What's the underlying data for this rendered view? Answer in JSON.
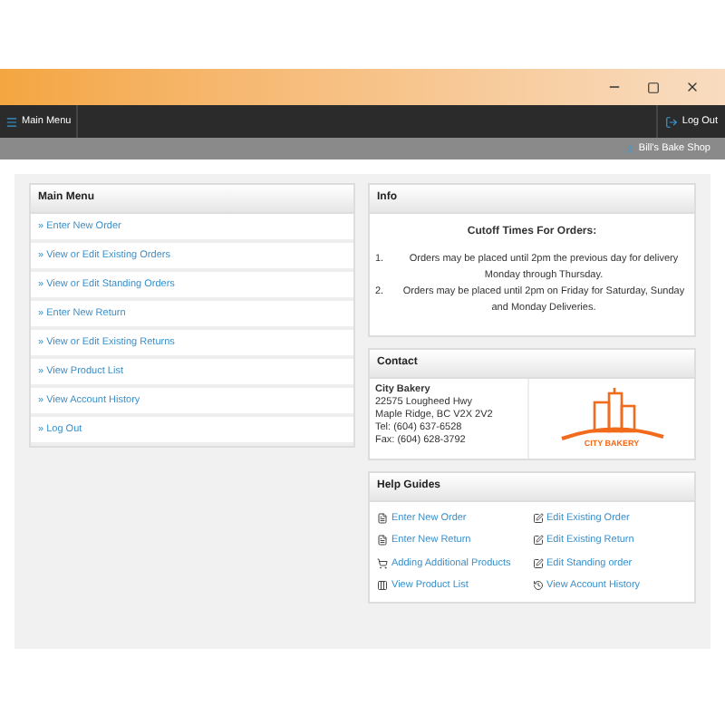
{
  "nav": {
    "menu_label": "Main Menu",
    "logout_label": "Log Out"
  },
  "user_bar": {
    "shop": "Bill's Bake Shop"
  },
  "main_menu": {
    "title": "Main Menu",
    "items": [
      {
        "label": "» Enter New Order"
      },
      {
        "label": "» View or Edit Existing Orders"
      },
      {
        "label": "» View or Edit Standing Orders"
      },
      {
        "label": "» Enter New Return"
      },
      {
        "label": "» View or Edit Existing Returns"
      },
      {
        "label": "» View Product List"
      },
      {
        "label": "» View Account History"
      },
      {
        "label": "» Log Out"
      }
    ]
  },
  "info": {
    "title": "Info",
    "heading": "Cutoff Times For Orders:",
    "items": [
      {
        "number": "1.",
        "text": "Orders may be placed until 2pm the previous day for delivery Monday through Thursday."
      },
      {
        "number": "2.",
        "text": "Orders may be placed until 2pm on Friday for Saturday, Sunday and Monday Deliveries."
      }
    ]
  },
  "contact": {
    "title": "Contact",
    "name": "City Bakery",
    "lines": [
      "22575 Lougheed Hwy",
      "Maple Ridge, BC V2X 2V2",
      "Tel: (604) 637-6528",
      "Fax: (604) 628-3792"
    ],
    "logo_text": "CITY BAKERY"
  },
  "help": {
    "title": "Help Guides",
    "items": [
      {
        "label": "Enter New Order",
        "kind": "document"
      },
      {
        "label": "Edit Existing Order",
        "kind": "edit"
      },
      {
        "label": "Enter New Return",
        "kind": "document"
      },
      {
        "label": "Edit Existing Return",
        "kind": "edit"
      },
      {
        "label": "Adding Additional Products",
        "kind": "cart"
      },
      {
        "label": "Edit Standing order",
        "kind": "edit"
      },
      {
        "label": "View Product List",
        "kind": "list"
      },
      {
        "label": "View Account History",
        "kind": "history"
      }
    ]
  }
}
